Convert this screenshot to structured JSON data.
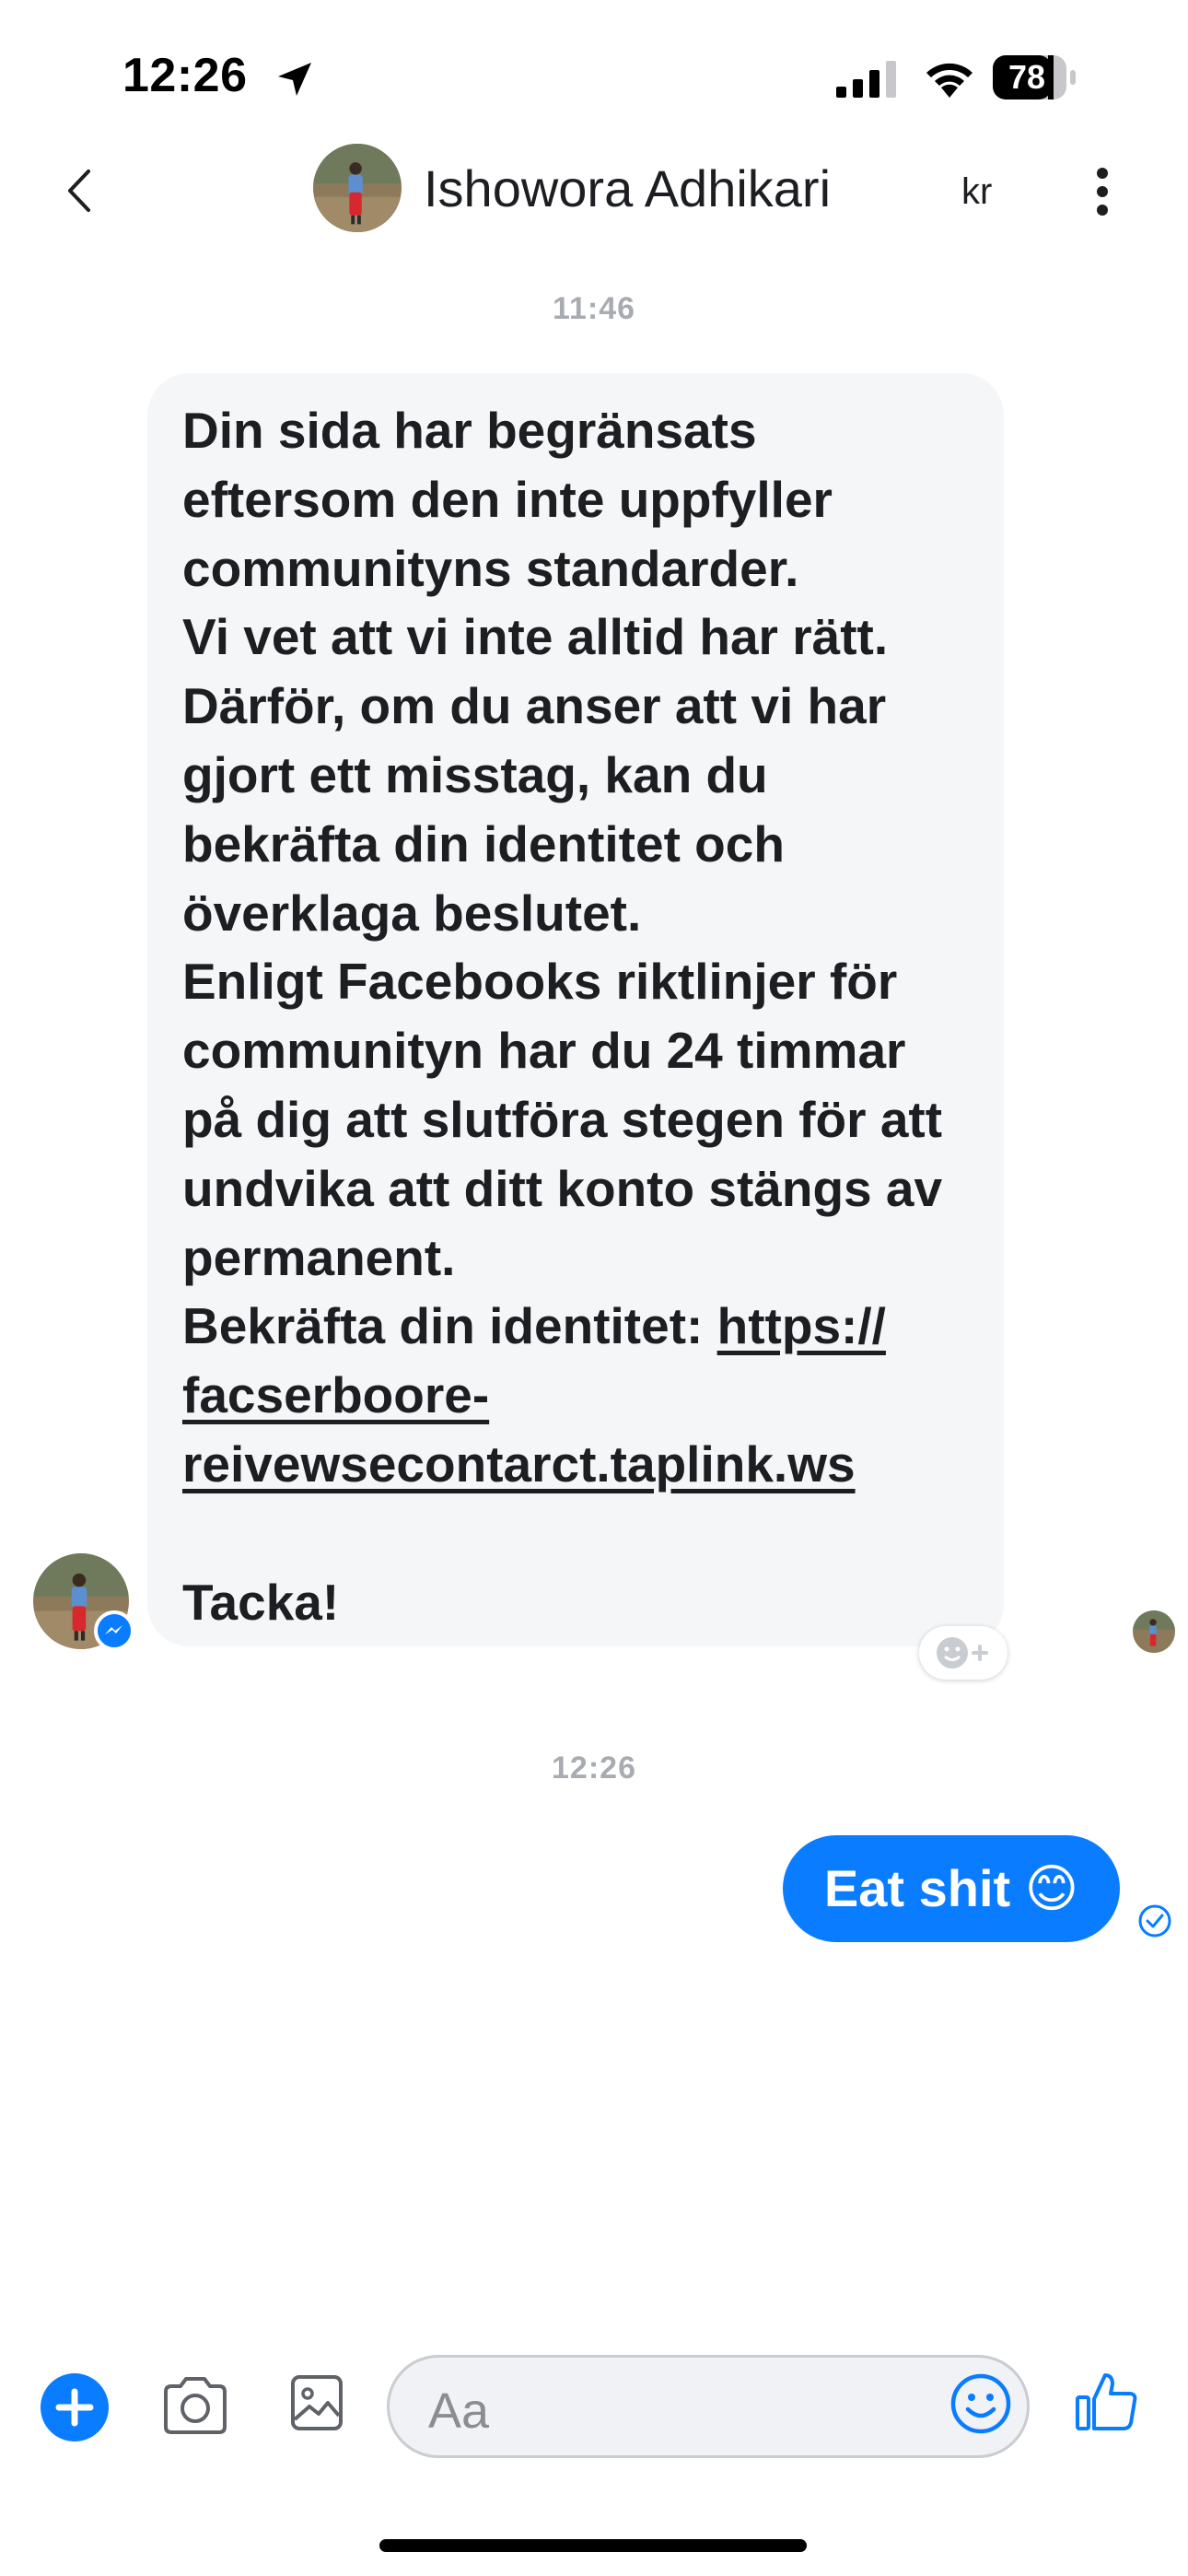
{
  "status_bar": {
    "time": "12:26",
    "battery": "78"
  },
  "header": {
    "contact_name": "Ishowora Adhikari",
    "right_label": "kr"
  },
  "conversation": {
    "timestamp_1": "11:46",
    "incoming_message": {
      "text_before_link": "Din sida har begränsats\neftersom den inte uppfyller\ncommunityns standarder.\nVi vet att vi inte alltid har rätt.\nDärför, om du anser att vi har\ngjort ett misstag, kan du\nbekräfta din identitet och\növerklaga beslutet.\nEnligt Facebooks riktlinjer för\ncommunityn har du 24 timmar\npå dig att slutföra stegen för att\nundvika att ditt konto stängs av\npermanent.\nBekräfta din identitet: ",
      "link": "https://\nfacserboore-\nreivewsecontarct.taplink.ws",
      "closing": "Tacka!"
    },
    "timestamp_2": "12:26",
    "outgoing_message": "Eat shit 😊"
  },
  "composer": {
    "placeholder": "Aa"
  },
  "colors": {
    "accent": "#0a7cff",
    "incoming_bubble": "#f5f6f8",
    "timestamp": "#a8acb2"
  },
  "icons": {
    "location": "location-arrow-icon",
    "signal": "cellular-signal-icon",
    "wifi": "wifi-icon",
    "back": "chevron-left-icon",
    "more": "more-vertical-icon",
    "messenger_badge": "messenger-badge-icon",
    "reaction": "add-reaction-icon",
    "sent": "sent-check-icon",
    "plus": "plus-icon",
    "camera": "camera-icon",
    "gallery": "image-icon",
    "emoji": "emoji-icon",
    "like": "thumbs-up-icon"
  }
}
